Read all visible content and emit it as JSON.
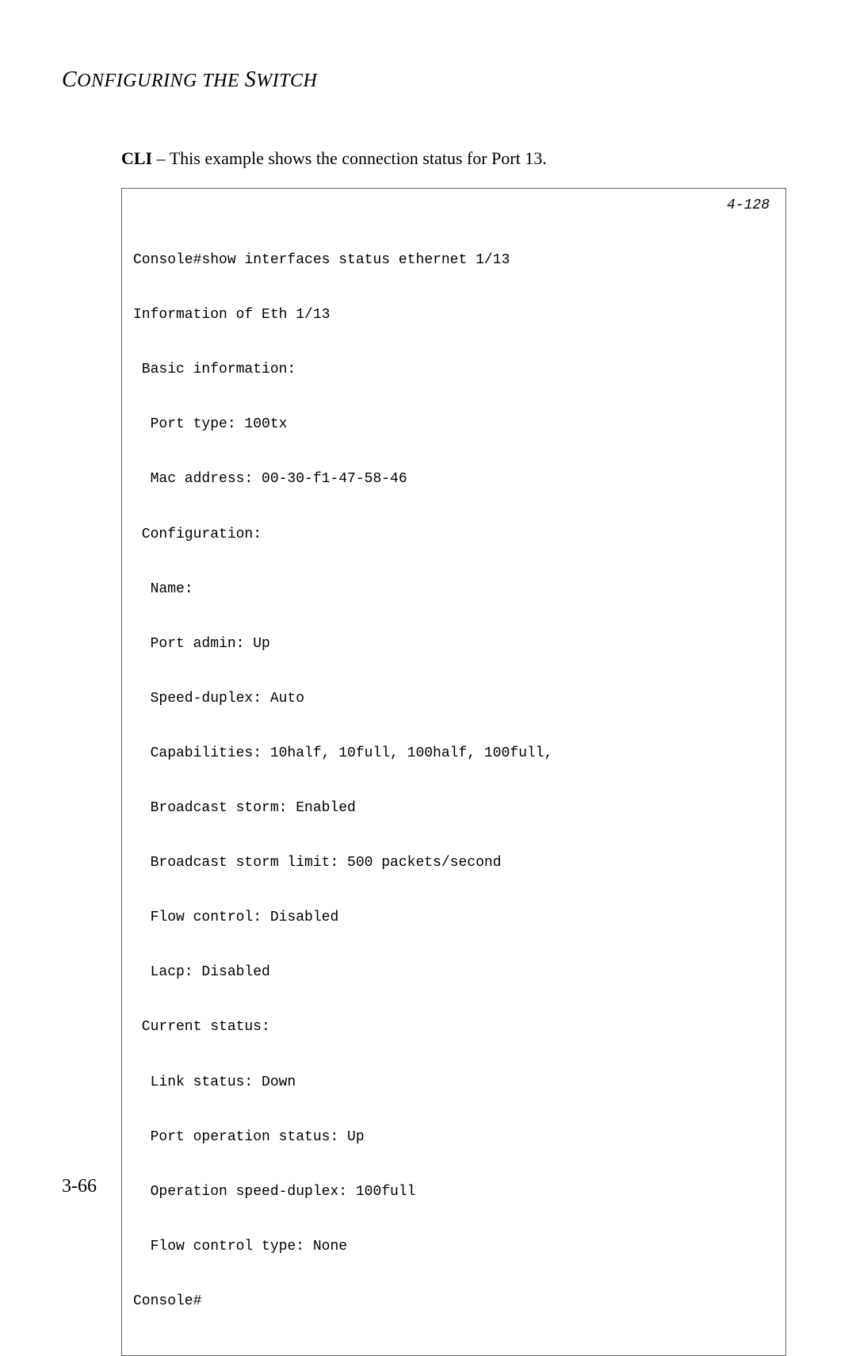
{
  "header": {
    "title_part1": "C",
    "title_part2": "ONFIGURING THE ",
    "title_part3": "S",
    "title_part4": "WITCH"
  },
  "intro": {
    "bold_part": "CLI",
    "rest": " – This example shows the connection status for Port 13."
  },
  "cli": {
    "page_ref": "4-128",
    "lines": [
      "Console#show interfaces status ethernet 1/13",
      "Information of Eth 1/13",
      " Basic information:",
      "  Port type: 100tx",
      "  Mac address: 00-30-f1-47-58-46",
      " Configuration:",
      "  Name:",
      "  Port admin: Up",
      "  Speed-duplex: Auto",
      "  Capabilities: 10half, 10full, 100half, 100full,",
      "  Broadcast storm: Enabled",
      "  Broadcast storm limit: 500 packets/second",
      "  Flow control: Disabled",
      "  Lacp: Disabled",
      " Current status:",
      "  Link status: Down",
      "  Port operation status: Up",
      "  Operation speed-duplex: 100full",
      "  Flow control type: None",
      "Console#"
    ]
  },
  "footer": {
    "page_number": "3-66"
  }
}
